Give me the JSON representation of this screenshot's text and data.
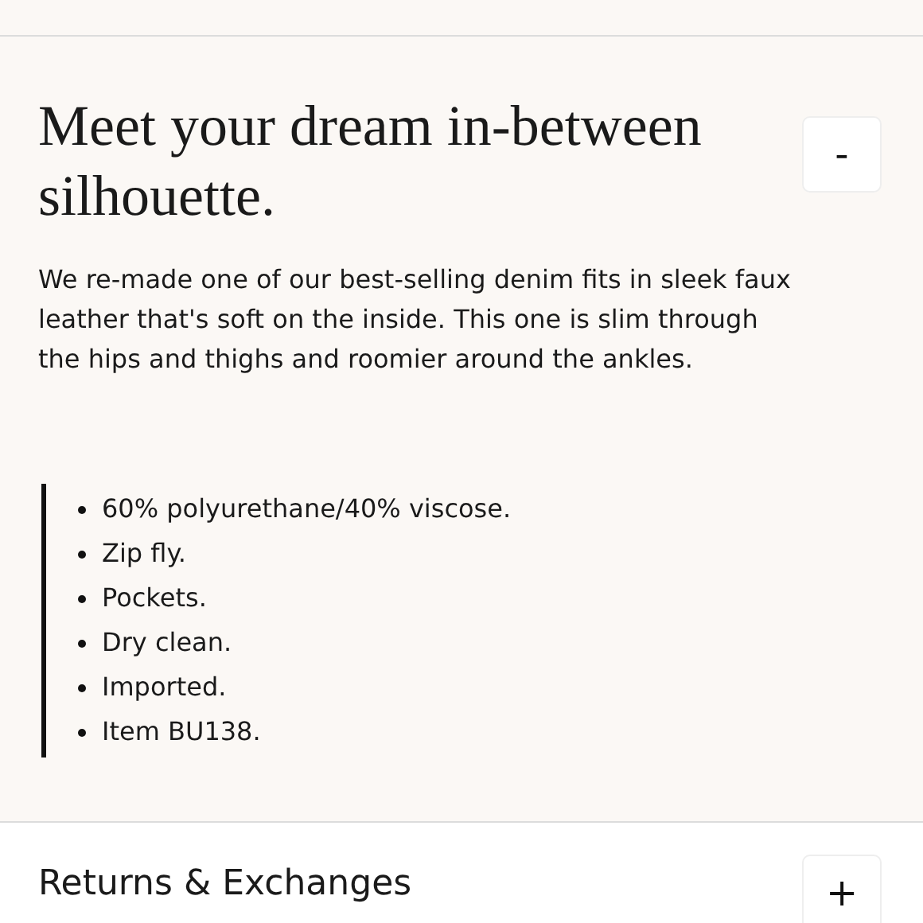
{
  "sections": [
    {
      "title": "Meet your dream in-between silhouette.",
      "toggle": "-",
      "expanded": true,
      "description": "We re-made one of our best-selling denim fits in sleek faux leather that's soft on the inside. This one is slim through the hips and thighs and roomier around the ankles.",
      "bullets": [
        "60% polyurethane/40% viscose.",
        "Zip fly.",
        "Pockets.",
        "Dry clean.",
        "Imported.",
        "Item BU138."
      ]
    },
    {
      "title": "Returns & Exchanges",
      "toggle": "+",
      "expanded": false
    }
  ]
}
